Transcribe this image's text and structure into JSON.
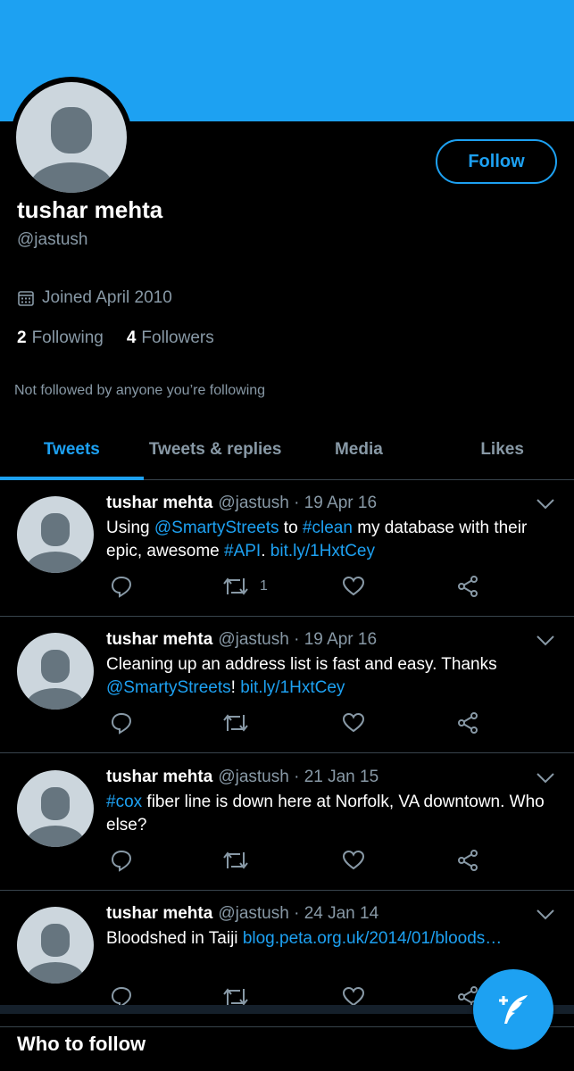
{
  "profile": {
    "name": "tushar mehta",
    "handle": "@jastush",
    "joined": "Joined April 2010",
    "following_count": "2",
    "following_label": "Following",
    "followers_count": "4",
    "followers_label": "Followers",
    "not_followed": "Not followed by anyone you’re following",
    "follow_button": "Follow"
  },
  "tabs": [
    {
      "label": "Tweets",
      "active": true
    },
    {
      "label": "Tweets & replies",
      "active": false
    },
    {
      "label": "Media",
      "active": false
    },
    {
      "label": "Likes",
      "active": false
    }
  ],
  "tweets": [
    {
      "name": "tushar mehta",
      "handle": "@jastush",
      "date": "· 19 Apr 16",
      "retweet_count": "1",
      "parts": [
        {
          "t": "Using ",
          "link": false
        },
        {
          "t": "@SmartyStreets",
          "link": true
        },
        {
          "t": " to ",
          "link": false
        },
        {
          "t": "#clean",
          "link": true
        },
        {
          "t": " my database with their epic, awesome ",
          "link": false
        },
        {
          "t": "#API",
          "link": true
        },
        {
          "t": ". ",
          "link": false
        },
        {
          "t": "bit.ly/1HxtCey",
          "link": true
        }
      ]
    },
    {
      "name": "tushar mehta",
      "handle": "@jastush",
      "date": "· 19 Apr 16",
      "retweet_count": "",
      "parts": [
        {
          "t": "Cleaning up an address list is fast and easy. Thanks ",
          "link": false
        },
        {
          "t": "@SmartyStreets",
          "link": true
        },
        {
          "t": "! ",
          "link": false
        },
        {
          "t": "bit.ly/1HxtCey",
          "link": true
        }
      ]
    },
    {
      "name": "tushar mehta",
      "handle": "@jastush",
      "date": "· 21 Jan 15",
      "retweet_count": "",
      "parts": [
        {
          "t": "#cox",
          "link": true
        },
        {
          "t": " fiber line is down here at Norfolk, VA downtown. Who else?",
          "link": false
        }
      ]
    },
    {
      "name": "tushar mehta",
      "handle": "@jastush",
      "date": "· 24 Jan 14",
      "retweet_count": "",
      "parts": [
        {
          "t": "Bloodshed in Taiji ",
          "link": false
        },
        {
          "t": "blog.peta.org.uk/2014/01/bloods…",
          "link": true
        }
      ]
    }
  ],
  "section": {
    "who_to_follow": "Who to follow"
  },
  "colors": {
    "accent": "#1da1f2",
    "background": "#000000",
    "muted_text": "#8899a6",
    "divider": "#38444d"
  },
  "icons": {
    "calendar": "calendar-icon",
    "reply": "reply-icon",
    "retweet": "retweet-icon",
    "like": "heart-icon",
    "share": "share-icon",
    "chevron": "chevron-down-icon",
    "compose": "compose-tweet-icon"
  }
}
